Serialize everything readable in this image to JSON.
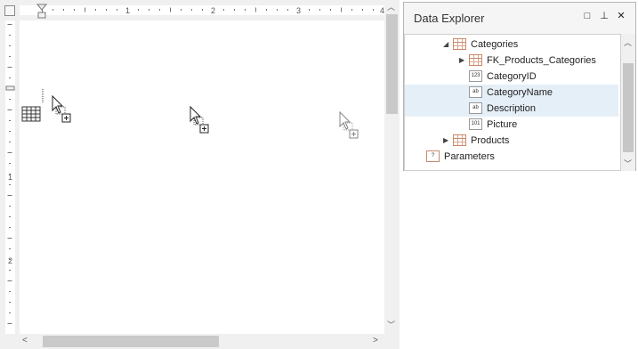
{
  "ruler": {
    "h_numbers": [
      "1",
      "2",
      "3",
      "4"
    ],
    "v_numbers": [
      "1",
      "2"
    ]
  },
  "panel": {
    "title": "Data Explorer",
    "buttons": {
      "maximize": "□",
      "pin": "⊥",
      "close": "✕"
    }
  },
  "tree": [
    {
      "label": "Categories",
      "level": 1,
      "expanded": true,
      "icon": "table-icon",
      "selected": false
    },
    {
      "label": "FK_Products_Categories",
      "level": 2,
      "expanded": false,
      "icon": "table-icon",
      "selected": false
    },
    {
      "label": "CategoryID",
      "level": 2,
      "icon": "numeric-field-icon",
      "icon_text": "123",
      "selected": false
    },
    {
      "label": "CategoryName",
      "level": 2,
      "icon": "text-field-icon",
      "icon_text": "ab",
      "selected": true
    },
    {
      "label": "Description",
      "level": 2,
      "icon": "text-field-icon",
      "icon_text": "ab",
      "selected": true
    },
    {
      "label": "Picture",
      "level": 2,
      "icon": "binary-field-icon",
      "icon_text": "101",
      "selected": false
    },
    {
      "label": "Products",
      "level": 1,
      "expanded": false,
      "icon": "table-icon",
      "selected": false
    },
    {
      "label": "Parameters",
      "level": 0,
      "icon": "parameter-icon",
      "icon_text": "?",
      "selected": false
    }
  ],
  "colors": {
    "selection": "#e5eff8",
    "table_icon": "#c98a6a"
  }
}
